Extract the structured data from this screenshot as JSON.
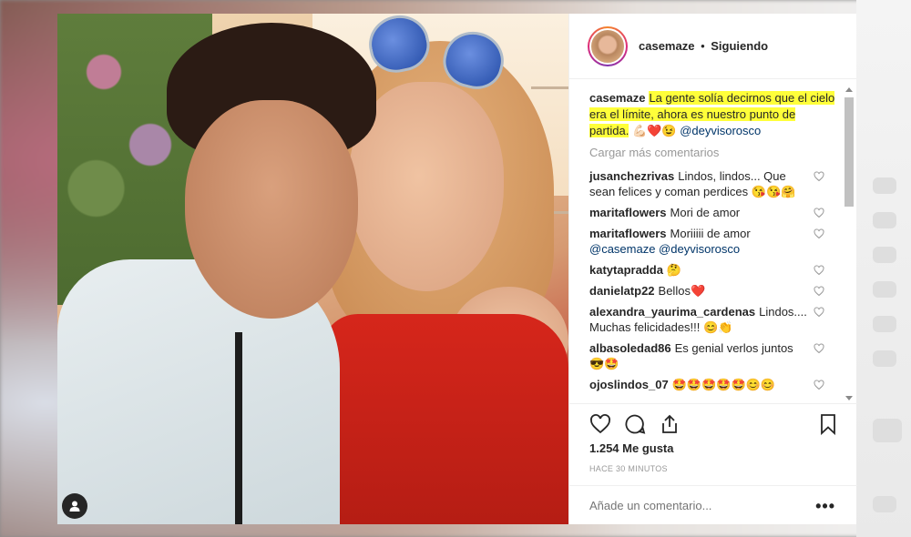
{
  "header": {
    "username": "casemaze",
    "separator": "•",
    "follow_status": "Siguiendo"
  },
  "caption": {
    "username": "casemaze",
    "text": "La gente solía decirnos que el cielo era el límite, ahora es nuestro punto de partida.",
    "emojis": "💪🏻❤️😉",
    "mention": "@deyvisorosco"
  },
  "load_more": "Cargar más comentarios",
  "comments": [
    {
      "username": "jusanchezrivas",
      "text": "Lindos, lindos... Que sean felices y coman perdices 😘😘🤗"
    },
    {
      "username": "maritaflowers",
      "text": "Mori de amor"
    },
    {
      "username": "maritaflowers",
      "text": "Moriiiii de amor",
      "mentions": "@casemaze @deyvisorosco"
    },
    {
      "username": "katytapradda",
      "text": "🤔"
    },
    {
      "username": "danielatp22",
      "text": "Bellos❤️"
    },
    {
      "username": "alexandra_yaurima_cardenas",
      "text": "Lindos.... Muchas felicidades!!! 😊👏"
    },
    {
      "username": "albasoledad86",
      "text": "Es genial verlos juntos 😎🤩"
    },
    {
      "username": "ojoslindos_07",
      "text": "🤩🤩🤩🤩🤩😊😊"
    }
  ],
  "likes": "1.254 Me gusta",
  "timestamp": "HACE 30 MINUTOS",
  "add_comment_placeholder": "Añade un comentario...",
  "more_options": "•••",
  "icons": {
    "like": "heart-icon",
    "comment": "comment-bubble-icon",
    "share": "share-icon",
    "save": "bookmark-icon",
    "user_tag": "user-tag-icon"
  },
  "colors": {
    "highlight": "#ffff3a",
    "mention": "#003569",
    "muted": "#999999"
  }
}
